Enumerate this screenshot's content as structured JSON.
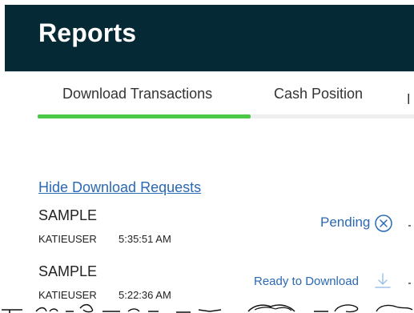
{
  "header": {
    "title": "Reports"
  },
  "tabs": [
    {
      "label": "Download Transactions",
      "active": true
    },
    {
      "label": "Cash Position",
      "active": false
    },
    {
      "label": "E",
      "active": false
    }
  ],
  "colors": {
    "header_bg": "#052a36",
    "accent_green": "#4cc847",
    "link_blue": "#2a69b3"
  },
  "downloads": {
    "toggle_label": "Hide Download Requests",
    "requests": [
      {
        "name": "SAMPLE",
        "user": "KATIEUSER",
        "time": "5:35:51 AM",
        "status": "Pending",
        "icon": "cancel-circle-icon"
      },
      {
        "name": "SAMPLE",
        "user": "KATIEUSER",
        "time": "5:22:36 AM",
        "status": "Ready to Download",
        "icon": "download-icon"
      }
    ]
  }
}
